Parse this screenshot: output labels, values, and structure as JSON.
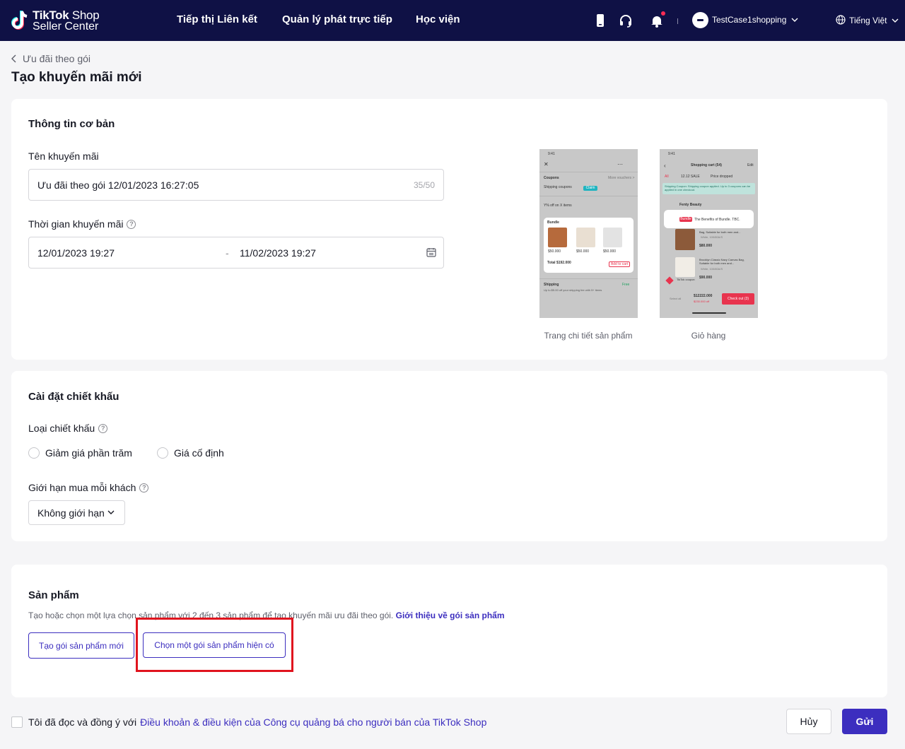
{
  "nav": {
    "logo_bold": "TikTok",
    "logo_thin": "Shop",
    "logo_line2": "Seller Center",
    "links": [
      "Tiếp thị Liên kết",
      "Quản lý phát trực tiếp",
      "Học viện"
    ],
    "user": "TestCase1shopping",
    "language": "Tiếng Việt",
    "icons": [
      "phone-icon",
      "headset-icon",
      "bell-icon",
      "globe-icon"
    ]
  },
  "breadcrumb": "Ưu đãi theo gói",
  "page_title": "Tạo khuyến mãi mới",
  "basic": {
    "title": "Thông tin cơ bản",
    "name_label": "Tên khuyến mãi",
    "name_value": "Ưu đãi theo gói 12/01/2023 16:27:05",
    "name_count": "35/50",
    "time_label": "Thời gian khuyến mãi",
    "time_start": "12/01/2023 19:27",
    "time_sep": "-",
    "time_end": "11/02/2023 19:27",
    "preview_captions": [
      "Trang chi tiết sản phẩm",
      "Giỏ hàng"
    ],
    "preview1": {
      "time": "9:41",
      "coupons": "Coupons",
      "more_vouchers": "More vouchers >",
      "shipping_coupon": "Shipping coupons",
      "claim": "Claim",
      "off_items": "Y% off on X items",
      "bundle": "Bundle",
      "total": "Total $192.000",
      "add_to_cart": "Add to cart",
      "shipping": "Shipping",
      "shipping_note": "Up to $5.00 off your shipping fee with 5+ items",
      "free": "Free",
      "prices": [
        "$50.000",
        "$50.000",
        "$50.000"
      ]
    },
    "preview2": {
      "time": "9:41",
      "title": "Shopping cart (54)",
      "edit": "Edit",
      "tabs": [
        "All",
        "12.12 SALE",
        "Price dropped"
      ],
      "coupon_note": "Shipping Coupon: Shipping coupon applied. Up to 3 coupons can be applied in one checkout.",
      "shop": "Fenty Beauty",
      "bundle_tag": "Bundle",
      "bundle_text": "The Benefits of Bundle. TBC.",
      "item1": "Bag, Suitable for both men and...",
      "item1_variant": "White, 100/80A/S",
      "item1_price": "$80.000",
      "item2": "Brooklyn Classic Navy Canvas Bag, Suitable for both men and...",
      "item2_variant": "White, 100/80A/S",
      "item2_price": "$90.000",
      "coupon": "TikTok coupon",
      "select_all": "Select all",
      "total": "$12222.000",
      "total_off": "$230.000 off",
      "checkout": "Check out (3)"
    }
  },
  "discount": {
    "title": "Cài đặt chiết khấu",
    "type_label": "Loại chiết khấu",
    "options": [
      "Giảm giá phần trăm",
      "Giá cố định"
    ],
    "limit_label": "Giới hạn mua mỗi khách",
    "limit_value": "Không giới hạn"
  },
  "products": {
    "title": "Sản phẩm",
    "desc": "Tạo hoặc chọn một lựa chọn sản phẩm với 2 đến 3 sản phẩm để tạo khuyến mãi ưu đãi theo gói.",
    "desc_link": "Giới thiệu về gói sản phẩm",
    "btn_new": "Tạo gói sản phẩm mới",
    "btn_existing": "Chọn một gói sản phẩm hiện có"
  },
  "footer": {
    "agree_text": "Tôi đã đọc và đồng ý với",
    "agree_link": "Điều khoản & điều kiện của Công cụ quảng bá cho người bán của TikTok Shop",
    "cancel": "Hủy",
    "submit": "Gửi"
  },
  "colors": {
    "nav_bg": "#0f1145",
    "primary": "#3c2ebf",
    "highlight": "#e0141e"
  }
}
